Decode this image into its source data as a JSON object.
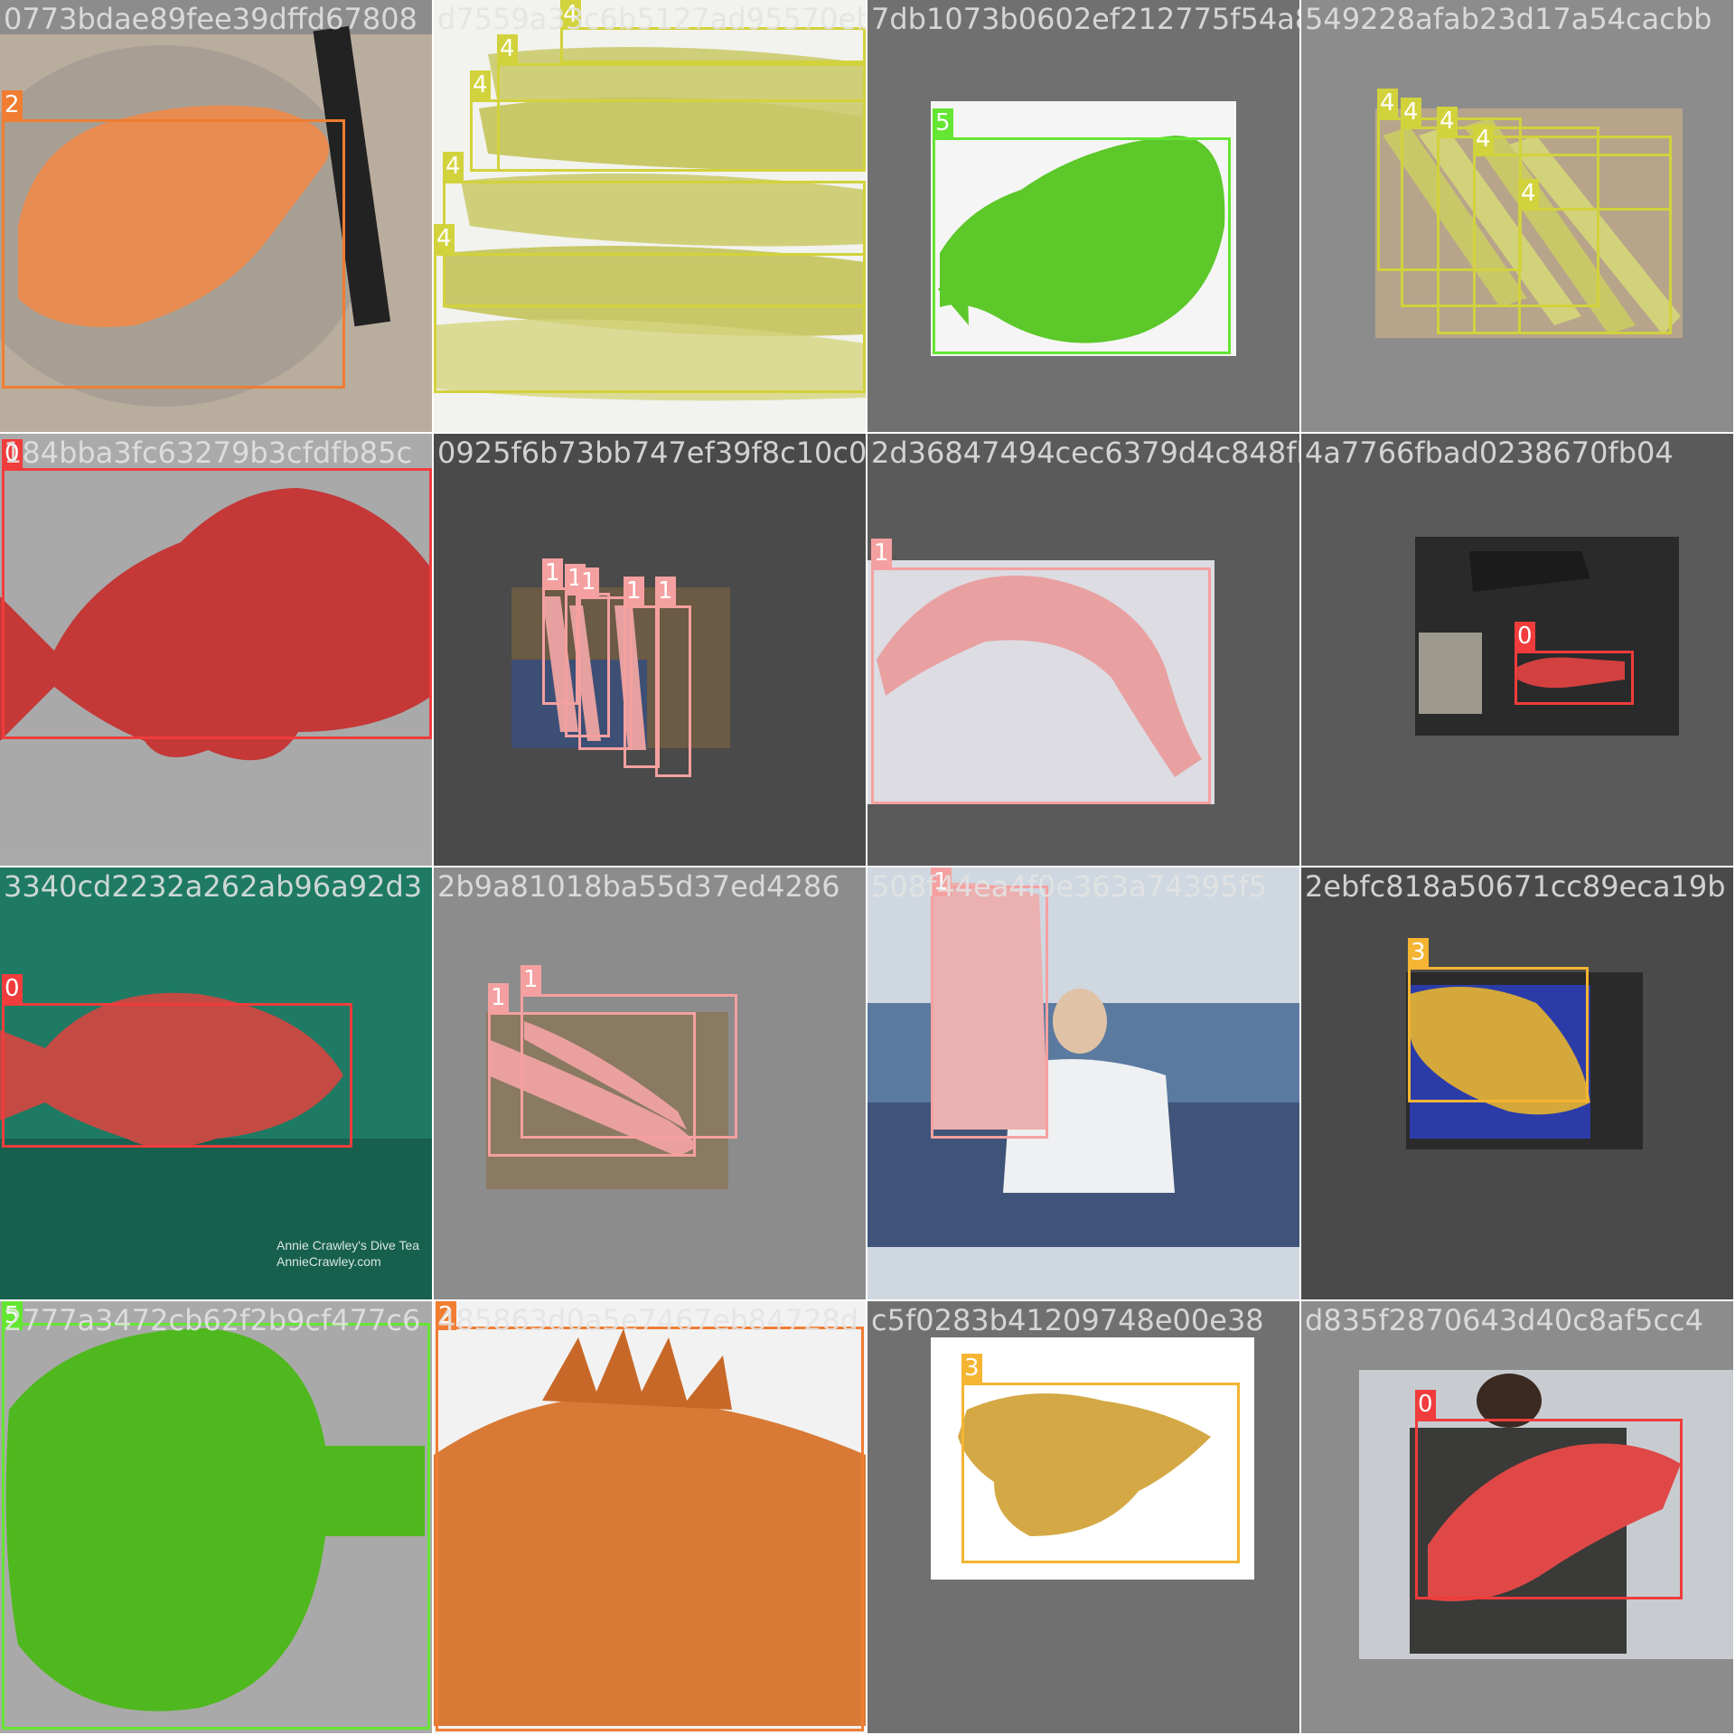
{
  "classes": {
    "0": {
      "color": "#f03c3c"
    },
    "1": {
      "color": "#f5a0a0"
    },
    "2": {
      "color": "#f07d32"
    },
    "3": {
      "color": "#f5b432"
    },
    "4": {
      "color": "#d2d23c"
    },
    "5": {
      "color": "#64e632"
    }
  },
  "tiles": [
    {
      "filename": "0773bdae89fee39dffd67808",
      "bg": "#8c8c8c",
      "labels": [
        "2"
      ],
      "scene": "rockfish-net"
    },
    {
      "filename": "d7559a33c6b5127ad95570eb",
      "bg": "#8c8c8c",
      "labels": [
        "4",
        "4",
        "4",
        "4",
        "4"
      ],
      "scene": "mackerel-pile"
    },
    {
      "filename": "7db1073b0602ef212775f54a85",
      "bg": "#707070",
      "labels": [
        "5"
      ],
      "scene": "flatfish-board"
    },
    {
      "filename": "549228afab23d17a54cacbb",
      "bg": "#8c8c8c",
      "labels": [
        "4",
        "4",
        "4",
        "4",
        "4"
      ],
      "scene": "mackerel-market"
    },
    {
      "filename": "184bba3fc63279b3cfdfb85c",
      "bg": "#aaaaaa",
      "labels": [
        "0"
      ],
      "scene": "red-rockfish-cutout"
    },
    {
      "filename": "0925f6b73bb747ef39f8c10c0b",
      "bg": "#4a4a4a",
      "labels": [
        "1",
        "1",
        "1",
        "1",
        "1"
      ],
      "scene": "eels-crate"
    },
    {
      "filename": "2d36847494cec6379d4c848fb",
      "bg": "#5a5a5a",
      "labels": [
        "1"
      ],
      "scene": "cutlassfish-box"
    },
    {
      "filename": "4a7766fbad0238670fb04",
      "bg": "#5a5a5a",
      "labels": [
        "0"
      ],
      "scene": "rockfish-ground"
    },
    {
      "filename": "3340cd2232a262ab96a92d3",
      "bg": "#1d6e5a",
      "labels": [
        "0"
      ],
      "scene": "rockfish-underwater",
      "caption": [
        "Annie Crawley's Dive Tea",
        "AnnieCrawley.com"
      ]
    },
    {
      "filename": "2b9a81018ba55d37ed4286",
      "bg": "#8c8c8c",
      "labels": [
        "1",
        "1"
      ],
      "scene": "eels-deck"
    },
    {
      "filename": "508f44ea4f0e363a74395f5",
      "bg": "#8c8c8c",
      "labels": [
        "1"
      ],
      "scene": "angler-cutlassfish"
    },
    {
      "filename": "2ebfc818a50671cc89eca19b",
      "bg": "#4a4a4a",
      "labels": [
        "3"
      ],
      "scene": "monkfish-basket"
    },
    {
      "filename": "2777a3472cb62f2b9cf477c6",
      "bg": "#aaaaaa",
      "labels": [
        "5"
      ],
      "scene": "flatfish-cutout"
    },
    {
      "filename": "485863d0a5e7467eb84728d",
      "bg": "#8c8c8c",
      "labels": [
        "2"
      ],
      "scene": "orange-rockfish-closeup"
    },
    {
      "filename": "c5f0283b41209748e00e38",
      "bg": "#707070",
      "labels": [
        "3"
      ],
      "scene": "monkfish-white"
    },
    {
      "filename": "d835f2870643d40c8af5cc4",
      "bg": "#8c8c8c",
      "labels": [
        "0"
      ],
      "scene": "rockfish-held"
    }
  ]
}
